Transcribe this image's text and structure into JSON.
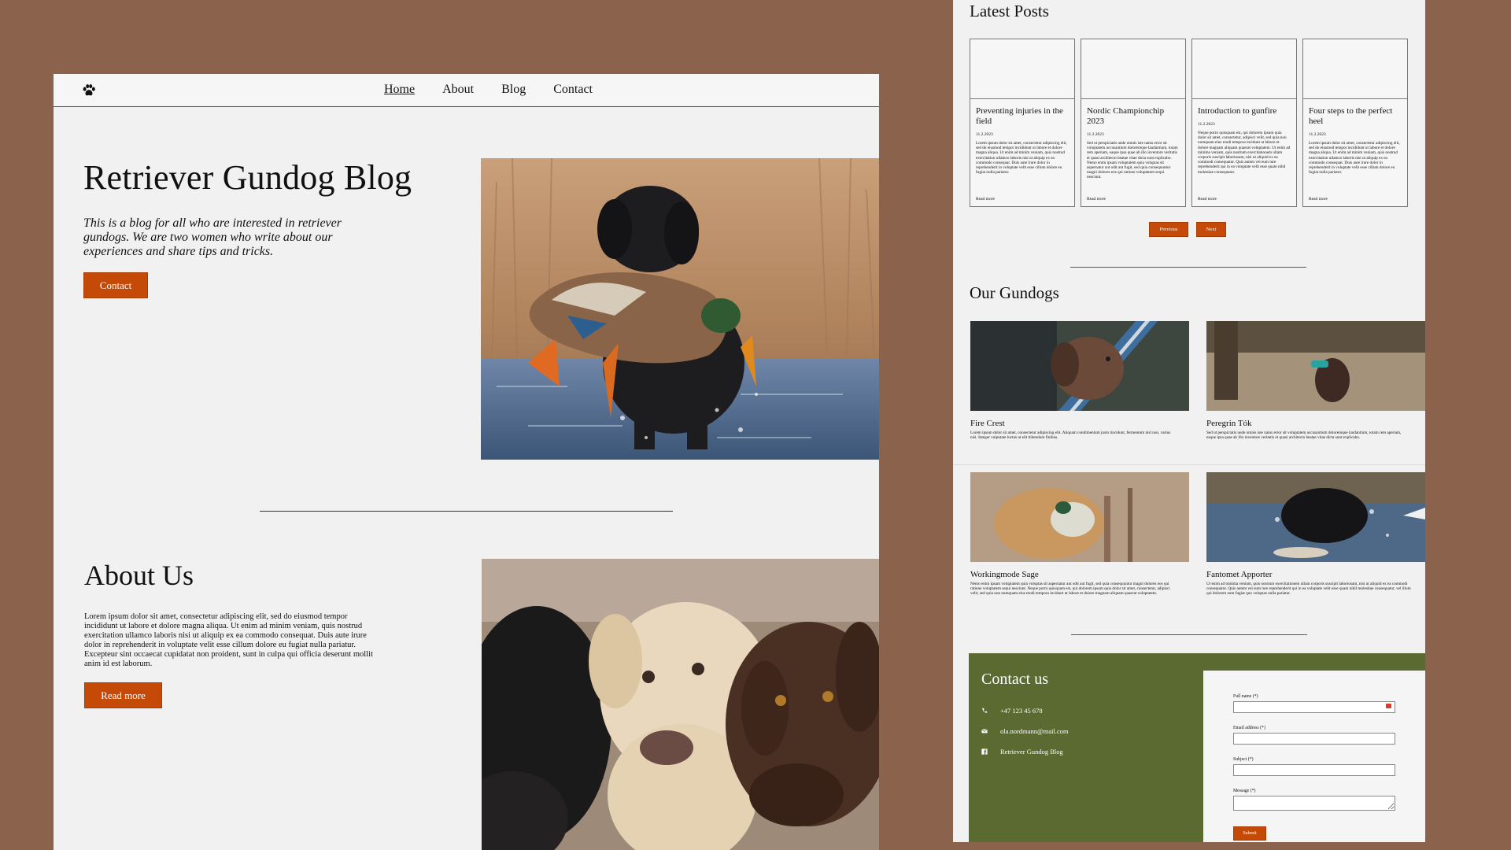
{
  "nav": {
    "items": [
      "Home",
      "About",
      "Blog",
      "Contact"
    ]
  },
  "hero": {
    "title": "Retriever Gundog Blog",
    "intro": "This is a blog for all who are interested in retriever gundogs. We are two women who write about our experiences and share tips and tricks.",
    "button": "Contact"
  },
  "about": {
    "title": "About Us",
    "text": "Lorem ipsum dolor sit amet, consectetur adipiscing elit, sed do eiusmod tempor incididunt ut labore et dolore magna aliqua. Ut enim ad minim veniam, quis nostrud exercitation ullamco laboris nisi ut aliquip ex ea commodo consequat. Duis aute irure dolor in reprehenderit in voluptate velit esse cillum dolore eu fugiat nulla pariatur. Excepteur sint occaecat cupidatat non proident, sunt in culpa qui officia deserunt mollit anim id est laborum.",
    "button": "Read more"
  },
  "posts": {
    "title": "Latest Posts",
    "cards": [
      {
        "title": "Preventing injuries in the field",
        "date": "11.2.2023",
        "text": "Lorem ipsum dolor sit amet, consectetur adipiscing elit, sed do eiusmod tempor incididunt ut labore et dolore magna aliqua. Ut enim ad minim veniam, quis nostrud exercitation ullamco laboris nisi ut aliquip ex ea commodo consequat. Duis aute irure dolor in reprehenderit in voluptate velit esse cillum dolore eu fugiat nulla pariatur.",
        "more": "Read more"
      },
      {
        "title": "Nordic Championchip 2023",
        "date": "11.2.2023",
        "text": "Sed ut perspiciatis unde omnis iste natus error sit voluptatem accusantium doloremque laudantium, totam rem aperiam, eaque ipsa quae ab illo inventore veritatis et quasi architecto beatae vitae dicta sunt explicabo. Nemo enim ipsam voluptatem quia voluptas sit aspernatur aut odit aut fugit, sed quia consequuntur magni dolores eos qui ratione voluptatem sequi nesciunt.",
        "more": "Read more"
      },
      {
        "title": "Introduction to gunfire",
        "date": "11.2.2023",
        "text": "Neque porro quisquam est, qui dolorem ipsum quia dolor sit amet, consectetur, adipisci velit, sed quia non numquam eius modi tempora incidunt ut labore et dolore magnam aliquam quaerat voluptatem. Ut enim ad minima veniam, quis nostrum exercitationem ullam corporis suscipit laboriosam, nisi ut aliquid ex ea commodi consequatur. Quis autem vel eum iure reprehenderit qui in ea voluptate velit esse quam nihil molestiae consequatur.",
        "more": "Read more"
      },
      {
        "title": "Four steps to the perfect heel",
        "date": "11.2.2023",
        "text": "Lorem ipsum dolor sit amet, consectetur adipiscing elit, sed do eiusmod tempor incididunt ut labore et dolore magna aliqua. Ut enim ad minim veniam, quis nostrud exercitation ullamco laboris nisi ut aliquip ex ea commodo consequat. Duis aute irure dolor in reprehenderit in voluptate velit esse cillum dolore eu fugiat nulla pariatur.",
        "more": "Read more"
      }
    ],
    "prev": "Previous",
    "next": "Next"
  },
  "gundogs": {
    "title": "Our Gundogs",
    "dogs": [
      {
        "name": "Fire Crest",
        "text": "Lorem ipsum dolor sit amet, consectetur adipiscing elit. Aliquam condimentum justo tincidunt, fermentum nisl non, varius nisi. Integer vulputate luctus ut elit bibendum finibus."
      },
      {
        "name": "Peregrin Tók",
        "text": "Sed ut perspiciatis unde omnis iste natus error sit voluptatem accusantium doloremque laudantium, totam rem aperiam, eaque ipsa quae ab illo inventore veritatis et quasi architecto beatae vitae dicta sunt explicabo."
      },
      {
        "name": "Workingmode Sage",
        "text": "Nemo enim ipsam voluptatem quia voluptas sit aspernatur aut odit aut fugit, sed quia consequuntur magni dolores eos qui ratione voluptatem sequi nesciunt. Neque porro quisquam est, qui dolorem ipsum quia dolor sit amet, consectetur, adipisci velit, sed quia non numquam eius modi tempora incidunt ut labore et dolore magnam aliquam quaerat voluptatem."
      },
      {
        "name": "Fantomet Apporter",
        "text": "Ut enim ad minima veniam, quis nostrum exercitationem ullam corporis suscipit laboriosam, nisi ut aliquid ex ea commodi consequatur. Quis autem vel eum iure reprehenderit qui in ea voluptate velit esse quam nihil molestiae consequatur, vel illum qui dolorem eum fugiat quo voluptas nulla pariatur."
      }
    ]
  },
  "contact": {
    "title": "Contact us",
    "phone": "+47 123 45 678",
    "email": "ola.nordmann@mail.com",
    "facebook": "Retriever Gundog Blog",
    "form": {
      "fullname_label": "Full name (*)",
      "email_label": "Email address (*)",
      "subject_label": "Subject (*)",
      "message_label": "Message (*)",
      "submit": "Submit"
    }
  },
  "colors": {
    "background": "#8b634c",
    "panel": "#f1f1f1",
    "accent": "#c54a08",
    "contact_green": "#5a6a30"
  }
}
